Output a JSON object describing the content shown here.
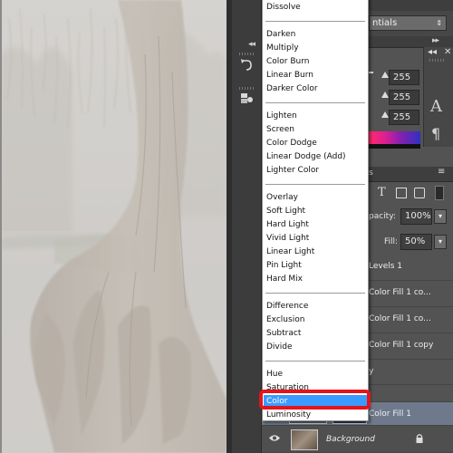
{
  "blend_menu": {
    "groups": [
      [
        "Dissolve"
      ],
      [
        "Darken",
        "Multiply",
        "Color Burn",
        "Linear Burn",
        "Darker Color"
      ],
      [
        "Lighten",
        "Screen",
        "Color Dodge",
        "Linear Dodge (Add)",
        "Lighter Color"
      ],
      [
        "Overlay",
        "Soft Light",
        "Hard Light",
        "Vivid Light",
        "Linear Light",
        "Pin Light",
        "Hard Mix"
      ],
      [
        "Difference",
        "Exclusion",
        "Subtract",
        "Divide"
      ],
      [
        "Hue",
        "Saturation",
        "Color",
        "Luminosity"
      ]
    ],
    "selected": "Color",
    "highlight_color": "#3c9bff",
    "annotation_color": "#e4141b"
  },
  "adjustments_panel": {
    "preset_partial": "ntials",
    "levels": [
      "255",
      "255",
      "255"
    ]
  },
  "layers_panel": {
    "tab_partial": "s",
    "opacity_label": "pacity:",
    "opacity_value": "100%",
    "fill_label": "Fill:",
    "fill_value": "50%",
    "layers": [
      {
        "name": "Levels 1"
      },
      {
        "name": "Color Fill 1 co..."
      },
      {
        "name": "Color Fill 1 co..."
      },
      {
        "name": "Color Fill 1 copy"
      },
      {
        "name": "y"
      },
      {
        "name": ""
      },
      {
        "name": "Color Fill 1"
      },
      {
        "name": "Background"
      }
    ]
  },
  "icons": {
    "type_tool": "T",
    "character": "A",
    "paragraph": "¶"
  }
}
